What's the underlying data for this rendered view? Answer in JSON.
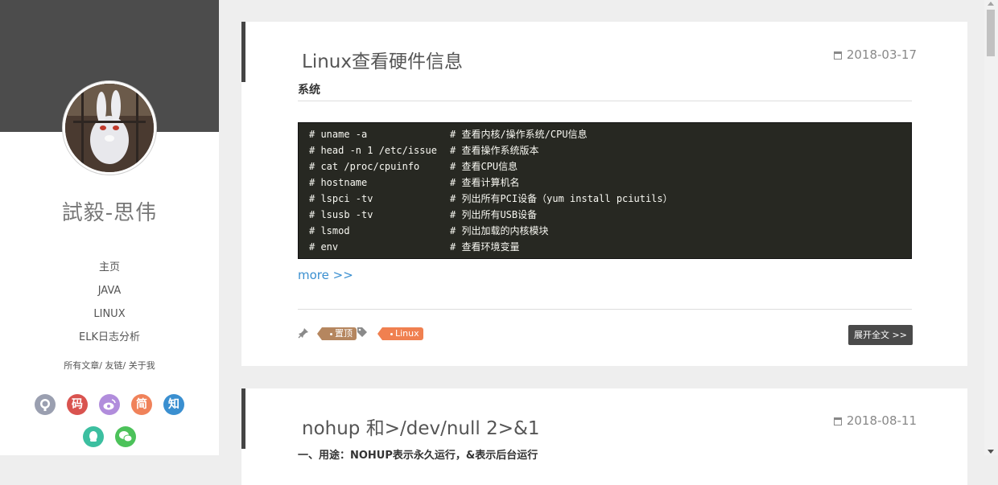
{
  "sidebar": {
    "site_title": "試毅-思伟",
    "nav": [
      {
        "label": "主页"
      },
      {
        "label": "JAVA"
      },
      {
        "label": "LINUX"
      },
      {
        "label": "ELK日志分析"
      }
    ],
    "sub_links": [
      "所有文章",
      "友链",
      "关于我"
    ],
    "social": [
      {
        "icon": "github-icon",
        "glyph": "",
        "color": "#9a9fb0"
      },
      {
        "icon": "gitee-icon",
        "glyph": "码",
        "color": "#d9534f"
      },
      {
        "icon": "weibo-icon",
        "glyph": "",
        "color": "#b18ddc"
      },
      {
        "icon": "jianshu-icon",
        "glyph": "简",
        "color": "#f0825a"
      },
      {
        "icon": "zhihu-icon",
        "glyph": "知",
        "color": "#3a8fd0"
      },
      {
        "icon": "qq-icon",
        "glyph": "",
        "color": "#3cbfa0"
      },
      {
        "icon": "wechat-icon",
        "glyph": "",
        "color": "#4cc25a"
      }
    ]
  },
  "posts": [
    {
      "title": "Linux查看硬件信息",
      "date": "2018-03-17",
      "section_heading": "系统",
      "code_lines": [
        {
          "cmd": "# uname -a",
          "comment": "# 查看内核/操作系统/CPU信息"
        },
        {
          "cmd": "# head -n 1 /etc/issue",
          "comment": "# 查看操作系统版本"
        },
        {
          "cmd": "# cat /proc/cpuinfo",
          "comment": "# 查看CPU信息"
        },
        {
          "cmd": "# hostname",
          "comment": "# 查看计算机名"
        },
        {
          "cmd": "# lspci -tv",
          "comment": "# 列出所有PCI设备（yum install pciutils）"
        },
        {
          "cmd": "# lsusb -tv",
          "comment": "# 列出所有USB设备"
        },
        {
          "cmd": "# lsmod",
          "comment": "# 列出加载的内核模块"
        },
        {
          "cmd": "# env",
          "comment": "# 查看环境变量"
        }
      ],
      "more_label": "more >>",
      "tags": [
        {
          "label": "置顶",
          "color": "#b5865f"
        },
        {
          "label": "Linux",
          "color": "#f08050"
        }
      ],
      "read_more_label": "展开全文 >>"
    },
    {
      "title": "nohup 和>/dev/null 2>&1",
      "date": "2018-08-11",
      "first_line": "一、用途：NOHUP表示永久运行，&表示后台运行"
    }
  ]
}
